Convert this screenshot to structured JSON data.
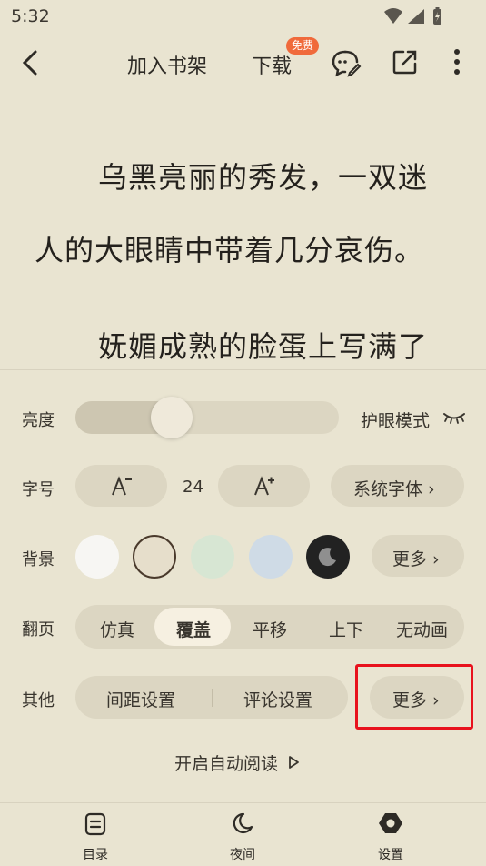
{
  "status": {
    "time": "5:32"
  },
  "topbar": {
    "add_shelf": "加入书架",
    "download": "下载",
    "free_badge": "免费"
  },
  "story": {
    "lines": [
      "乌黑亮丽的秀发，一双迷",
      "人的大眼睛中带着几分哀伤。",
      "妩媚成熟的脸蛋上写满了"
    ]
  },
  "settings": {
    "brightness": {
      "label": "亮度",
      "level": 0.34,
      "eye_mode": "护眼模式"
    },
    "font_size": {
      "label": "字号",
      "value": "24",
      "font_btn": "系统字体 ›"
    },
    "background": {
      "label": "背景",
      "more": "更多 ›",
      "options": [
        "#f7f6f3",
        "#e6decb",
        "#d7e6d3",
        "#cfdbe6",
        "#222222"
      ],
      "selected": 1
    },
    "page_turn": {
      "label": "翻页",
      "options": [
        "仿真",
        "覆盖",
        "平移",
        "上下",
        "无动画"
      ],
      "selected": 1
    },
    "other": {
      "label": "其他",
      "spacing": "间距设置",
      "comment": "评论设置",
      "more": "更多 ›"
    },
    "auto_read": "开启自动阅读"
  },
  "bottom_nav": {
    "catalog": "目录",
    "night": "夜间",
    "settings": "设置"
  }
}
